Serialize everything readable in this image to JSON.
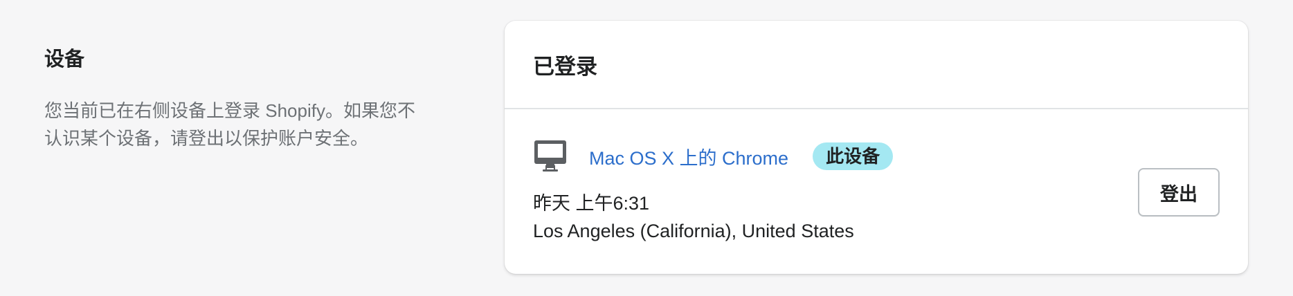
{
  "section": {
    "title": "设备",
    "description": "您当前已在右侧设备上登录 Shopify。如果您不认识某个设备，请登出以保护账户安全。"
  },
  "card": {
    "title": "已登录",
    "device": {
      "icon": "monitor-icon",
      "name": "Mac OS X 上的 Chrome",
      "badge": "此设备",
      "time": "昨天 上午6:31",
      "location": "Los Angeles (California), United States"
    },
    "logout_label": "登出"
  },
  "colors": {
    "link": "#2c6ecb",
    "badge_bg": "#a4e8f2",
    "page_bg": "#f6f6f7"
  }
}
